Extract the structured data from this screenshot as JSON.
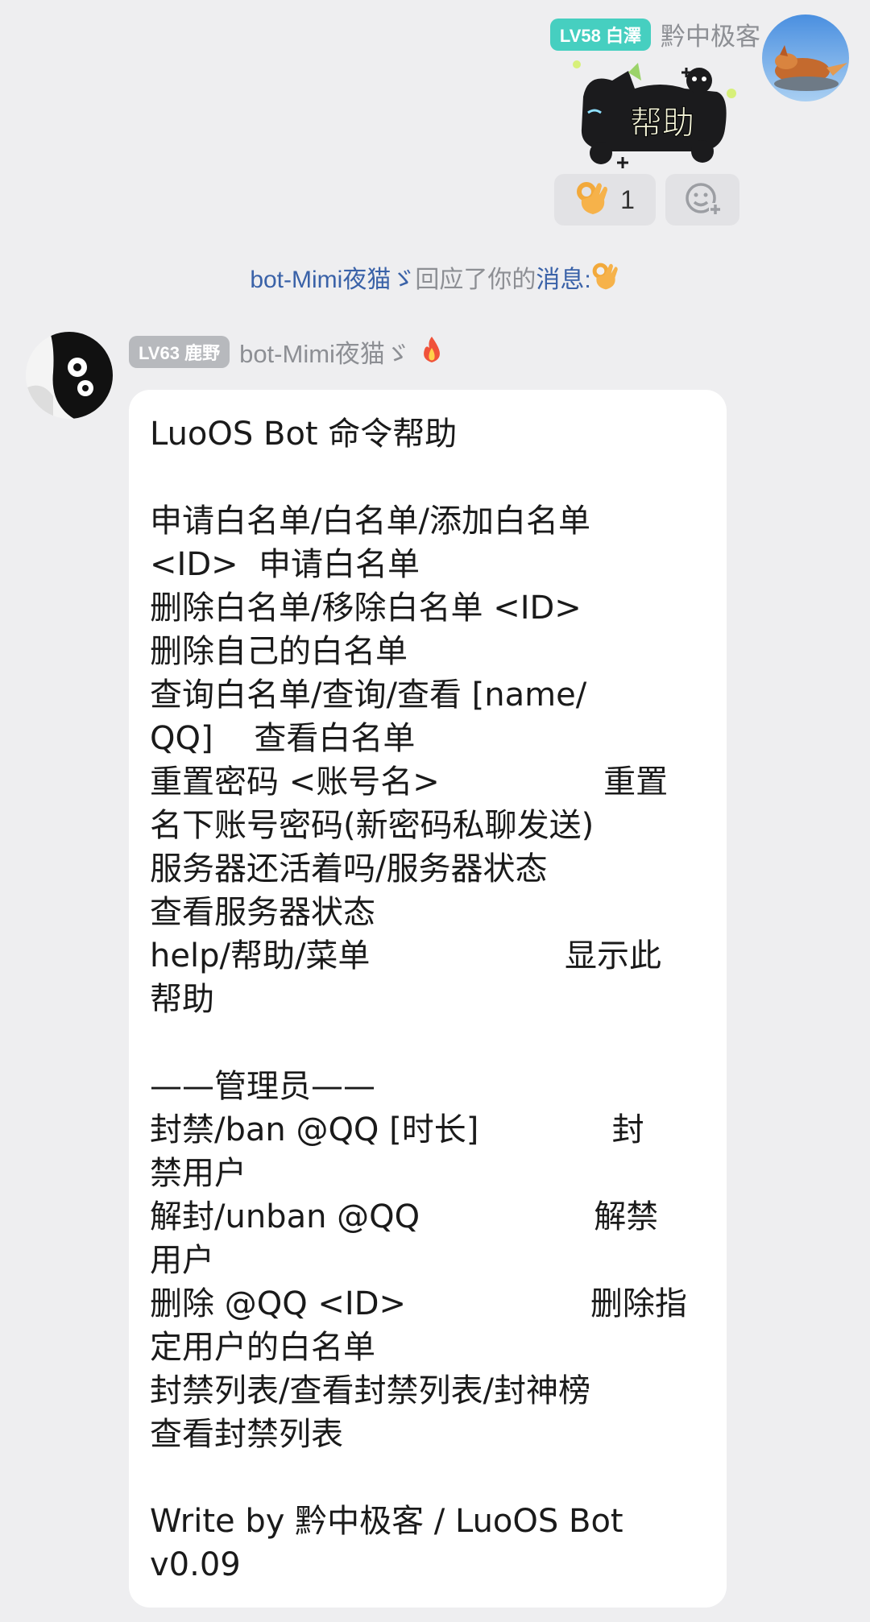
{
  "self_message": {
    "level_badge": "LV58 白澤",
    "sender": "黔中极客",
    "sticker_text": "帮助",
    "reactions": [
      {
        "icon": "ok-hand-emoji",
        "count": "1"
      },
      {
        "icon": "add-reaction-icon"
      }
    ]
  },
  "notice": {
    "actor": "bot-Mimi夜猫ゞ",
    "verb": "回应了你的",
    "target": "消息:",
    "emoji_icon": "ok-hand-emoji"
  },
  "bot_message": {
    "level_badge": "LV63 鹿野",
    "sender": "bot-Mimi夜猫ゞ",
    "badge_icon": "fire-icon",
    "lines": [
      "LuoOS Bot 命令帮助",
      "",
      "申请白名单/白名单/添加白名单",
      "<ID>  申请白名单",
      "删除白名单/移除白名单 <ID>",
      "删除自己的白名单",
      "查询白名单/查询/查看 [name/",
      "QQ]    查看白名单",
      "重置密码 <账号名>                重置",
      "名下账号密码(新密码私聊发送)",
      "服务器还活着吗/服务器状态",
      "查看服务器状态",
      "help/帮助/菜单                   显示此",
      "帮助",
      "",
      "——管理员——",
      "封禁/ban @QQ [时长]             封",
      "禁用户",
      "解封/unban @QQ                 解禁",
      "用户",
      "删除 @QQ <ID>                  删除指",
      "定用户的白名单",
      "封禁列表/查看封禁列表/封神榜",
      "查看封禁列表",
      "",
      "Write by 黔中极客 / LuoOS Bot",
      "v0.09"
    ]
  },
  "colors": {
    "background": "#eeeef0",
    "self_badge": "#46cfc0",
    "bot_badge": "#b7b9bd",
    "link": "#3a62a8",
    "bubble": "#ffffff"
  }
}
